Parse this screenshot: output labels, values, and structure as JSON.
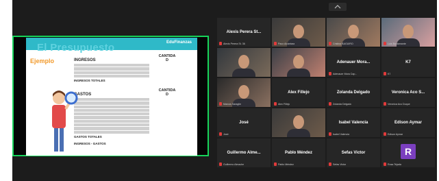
{
  "shared_screen": {
    "brand": "EduFinanzas",
    "slide_title": "El Presupuesto",
    "slide_subtitle": "Ejemplo",
    "ingresos_header": "INGRESOS",
    "cantidad_label_1": "CANTIDA\nD",
    "gastos_header": "GASTOS",
    "cantidad_label_2": "CANTIDA\nD",
    "ingresos_totales": "INGRESOS TOTALES",
    "gastos_totales": "GASTOS TOTALES",
    "ingresos_ahorro": "INGRESOS - GASTOS"
  },
  "participants": [
    {
      "name": "Alexis Perera St...",
      "label": "Alexis Perera St. 36",
      "video": false
    },
    {
      "name": "",
      "label": "Paco Alcántara",
      "video": true
    },
    {
      "name": "",
      "label": "Cristina BAGUIRO",
      "video": true,
      "active": true
    },
    {
      "name": "",
      "label": "Luis Bustamante",
      "video": true
    },
    {
      "name": "",
      "label": "",
      "video": true
    },
    {
      "name": "",
      "label": "",
      "video": true
    },
    {
      "name": "Adenauer Mora...",
      "label": "Adenauer Mora Cap...",
      "video": false
    },
    {
      "name": "K7",
      "label": "K7",
      "video": false
    },
    {
      "name": "",
      "label": "Marcos Saraglie",
      "video": true
    },
    {
      "name": "Alex Fillejo",
      "label": "Alex Fillejo",
      "video": false
    },
    {
      "name": "Zolanda Delgado",
      "label": "Zolanda Delgado",
      "video": false
    },
    {
      "name": "Veronica Aco S...",
      "label": "Veronica Aco Duque",
      "video": false
    },
    {
      "name": "José",
      "label": "José",
      "video": false
    },
    {
      "name": "",
      "label": "",
      "video": true
    },
    {
      "name": "Isabel Valencia",
      "label": "Isabel Valencia",
      "video": false
    },
    {
      "name": "Edison Aymar",
      "label": "Edison Aymar",
      "video": false
    },
    {
      "name": "Guillermo Alme...",
      "label": "Guillermo Almache",
      "video": false
    },
    {
      "name": "Pablo Méndez",
      "label": "Pablo Méndez",
      "video": false
    },
    {
      "name": "Sefas Victor",
      "label": "Sefas Victor",
      "video": false
    },
    {
      "name": "R",
      "label": "Rosa Tejada",
      "video": false,
      "avatar": true
    }
  ],
  "colors": {
    "active_speaker": "#a0d911",
    "share_border": "#17d45a",
    "mic_muted": "#e03a3a",
    "avatar": "#7b3fbf"
  }
}
